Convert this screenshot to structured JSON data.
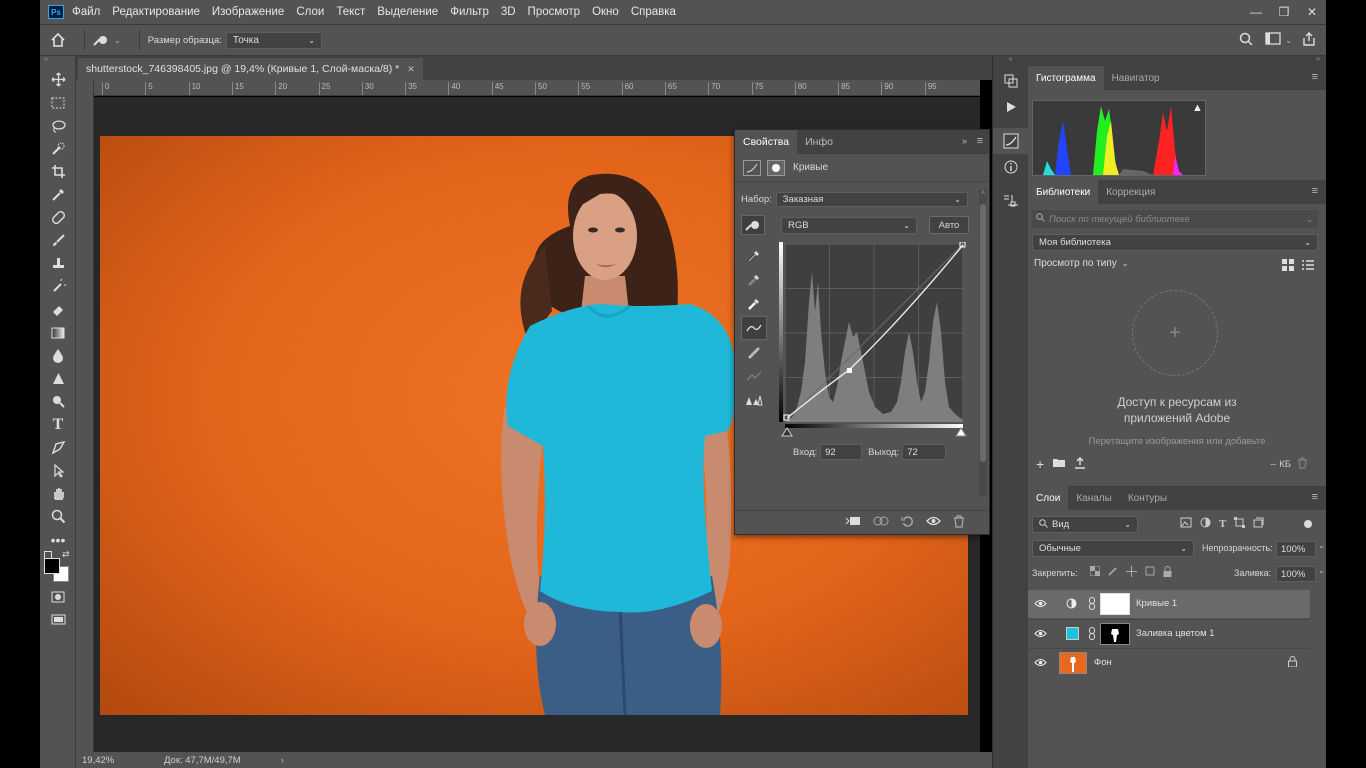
{
  "menubar": {
    "logo": "Ps",
    "items": [
      "Файл",
      "Редактирование",
      "Изображение",
      "Слои",
      "Текст",
      "Выделение",
      "Фильтр",
      "3D",
      "Просмотр",
      "Окно",
      "Справка"
    ],
    "win_minimize": "—",
    "win_restore": "❐",
    "win_close": "✕"
  },
  "optbar": {
    "sample_size_label": "Размер образца:",
    "sample_size_value": "Точка"
  },
  "document": {
    "tab_title": "shutterstock_746398405.jpg @ 19,4% (Кривые 1, Слой-маска/8) *",
    "close": "✕",
    "ruler_marks": [
      "0",
      "5",
      "10",
      "15",
      "20",
      "25",
      "30",
      "35",
      "40",
      "45",
      "50",
      "55",
      "60",
      "65",
      "70",
      "75",
      "80",
      "85",
      "90",
      "95"
    ],
    "zoom": "19,42%",
    "doc_size": "Док: 47,7M/49,7M"
  },
  "properties": {
    "tab_props": "Свойства",
    "tab_info": "Инфо",
    "adjustment_name": "Кривые",
    "preset_label": "Набор:",
    "preset_value": "Заказная",
    "channel_value": "RGB",
    "auto_button": "Авто",
    "input_label": "Вход:",
    "input_value": "92",
    "output_label": "Выход:",
    "output_value": "72"
  },
  "histogram_panel": {
    "tab_histogram": "Гистограмма",
    "tab_navigator": "Навигатор",
    "warning": "▲"
  },
  "libraries_panel": {
    "tab_libraries": "Библиотеки",
    "tab_correction": "Коррекция",
    "search_placeholder": "Поиск по текущей библиотеке",
    "library_value": "Моя библиотека",
    "view_by_type": "Просмотр по типу",
    "empty_title_line1": "Доступ к ресурсам из",
    "empty_title_line2": "приложений Adobe",
    "empty_hint": "Перетащите изображения или добавьте",
    "storage": "-- КБ"
  },
  "layers_panel": {
    "tab_layers": "Слои",
    "tab_channels": "Каналы",
    "tab_paths": "Контуры",
    "filter_value": "Вид",
    "blend_mode": "Обычные",
    "opacity_label": "Непрозрачность:",
    "opacity_value": "100%",
    "lock_label": "Закрепить:",
    "fill_label": "Заливка:",
    "fill_value": "100%",
    "layers": [
      {
        "name": "Кривые 1",
        "selected": true
      },
      {
        "name": "Заливка цветом 1",
        "selected": false
      },
      {
        "name": "Фон",
        "selected": false
      }
    ]
  },
  "colors": {
    "accent": "#31a8ff",
    "panel": "#535353",
    "panel_dark": "#424242",
    "orange": "#e8691e",
    "shirt": "#1fb8d8",
    "fill_swatch": "#1fc1e0"
  }
}
